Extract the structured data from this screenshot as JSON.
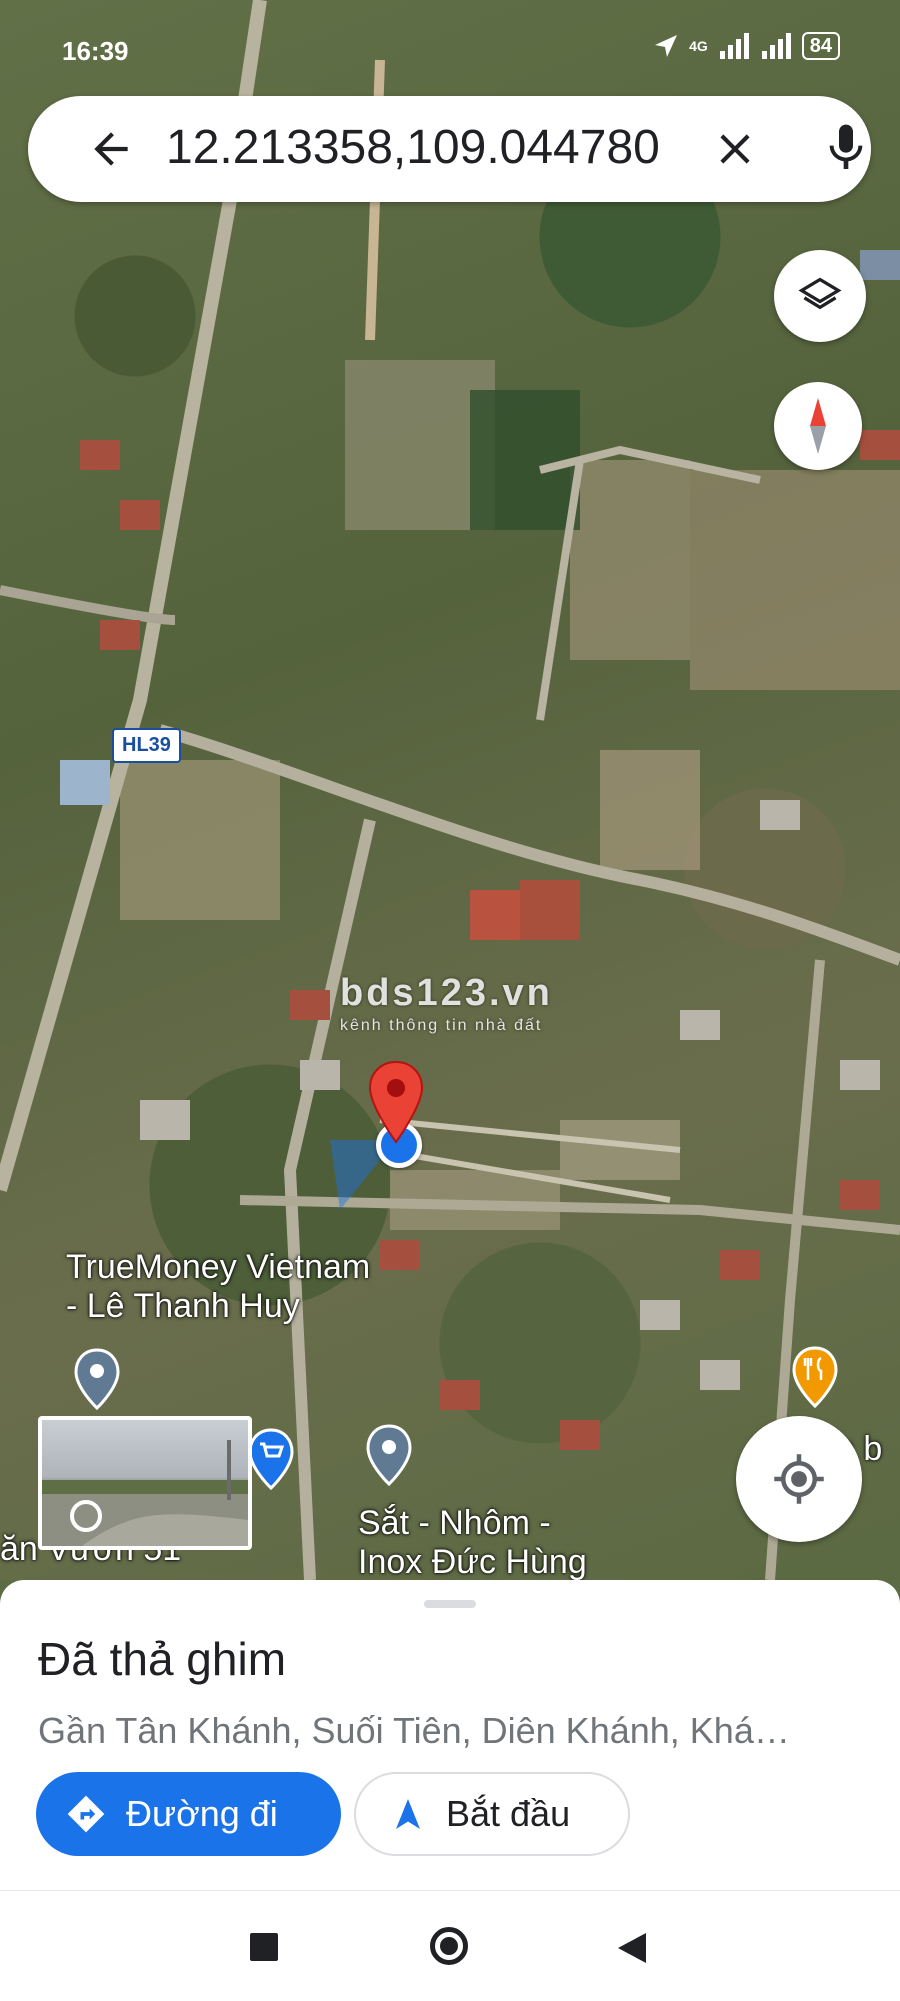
{
  "status": {
    "time": "16:39",
    "network": "4G",
    "battery": "84"
  },
  "search": {
    "query": "12.213358,109.044780",
    "back_icon": "arrow-back-icon",
    "clear_icon": "close-icon",
    "mic_icon": "mic-icon"
  },
  "map": {
    "road_label": "HL39",
    "watermark_title": "bds123.vn",
    "watermark_subtitle": "kênh thông tin nhà đất",
    "pois": [
      {
        "line1": "TrueMoney Vietnam",
        "line2": "- Lê Thanh Huy"
      },
      {
        "line1": "Sắt - Nhôm -",
        "line2": "Inox Đức Hùng"
      },
      {
        "line1": "ăn Vườn 51"
      },
      {
        "line1": "n b"
      }
    ],
    "accent_pin": "#ea4335",
    "accent_blue": "#1a73e8"
  },
  "sheet": {
    "title": "Đã thả ghim",
    "subtitle": "Gần Tân Khánh, Suối Tiên, Diên Khánh, Khá…",
    "directions_label": "Đường đi",
    "start_label": "Bắt đầu"
  }
}
